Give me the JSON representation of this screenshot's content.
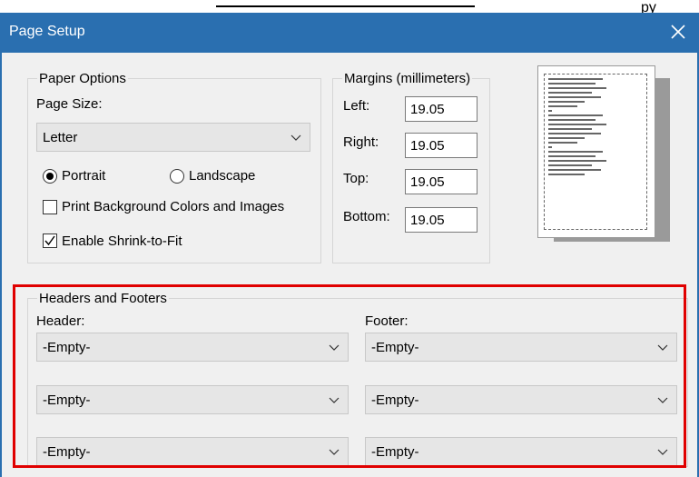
{
  "background": {
    "partial_text": "py"
  },
  "dialog": {
    "title": "Page Setup",
    "paper_options": {
      "legend": "Paper Options",
      "page_size_label": "Page Size:",
      "page_size_value": "Letter",
      "portrait_label": "Portrait",
      "landscape_label": "Landscape",
      "orientation_selected": "Portrait",
      "print_background_label": "Print Background Colors and Images",
      "print_background_checked": false,
      "shrink_label": "Enable Shrink-to-Fit",
      "shrink_checked": true
    },
    "margins": {
      "legend": "Margins (millimeters)",
      "left_label": "Left:",
      "left_value": "19.05",
      "right_label": "Right:",
      "right_value": "19.05",
      "top_label": "Top:",
      "top_value": "19.05",
      "bottom_label": "Bottom:",
      "bottom_value": "19.05"
    },
    "headers_footers": {
      "legend": "Headers and Footers",
      "header_label": "Header:",
      "footer_label": "Footer:",
      "header_values": [
        "-Empty-",
        "-Empty-",
        "-Empty-"
      ],
      "footer_values": [
        "-Empty-",
        "-Empty-",
        "-Empty-"
      ]
    },
    "icons": {
      "close": "close-icon",
      "chevron": "chevron-down-icon",
      "check": "checkmark-icon"
    },
    "colors": {
      "titlebar": "#2a6fb0",
      "highlight": "#e00000"
    }
  }
}
